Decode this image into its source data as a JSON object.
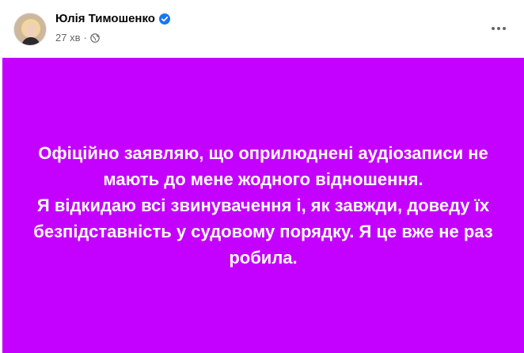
{
  "author": {
    "name": "Юлія Тимошенко",
    "verified": true
  },
  "meta": {
    "time": "27 хв",
    "separator": "·",
    "privacy_icon": "globe-icon"
  },
  "more_menu_icon": "more-dots-icon",
  "card": {
    "background": "#c400ff",
    "text_color": "#ffffff",
    "paragraphs": [
      "Офіційно заявляю, що оприлюднені аудіозаписи не мають до мене жодного відношення.",
      "Я відкидаю всі звинувачення і, як завжди, доведу їх безпідставність у судовому порядку. Я це вже не раз робила."
    ]
  }
}
